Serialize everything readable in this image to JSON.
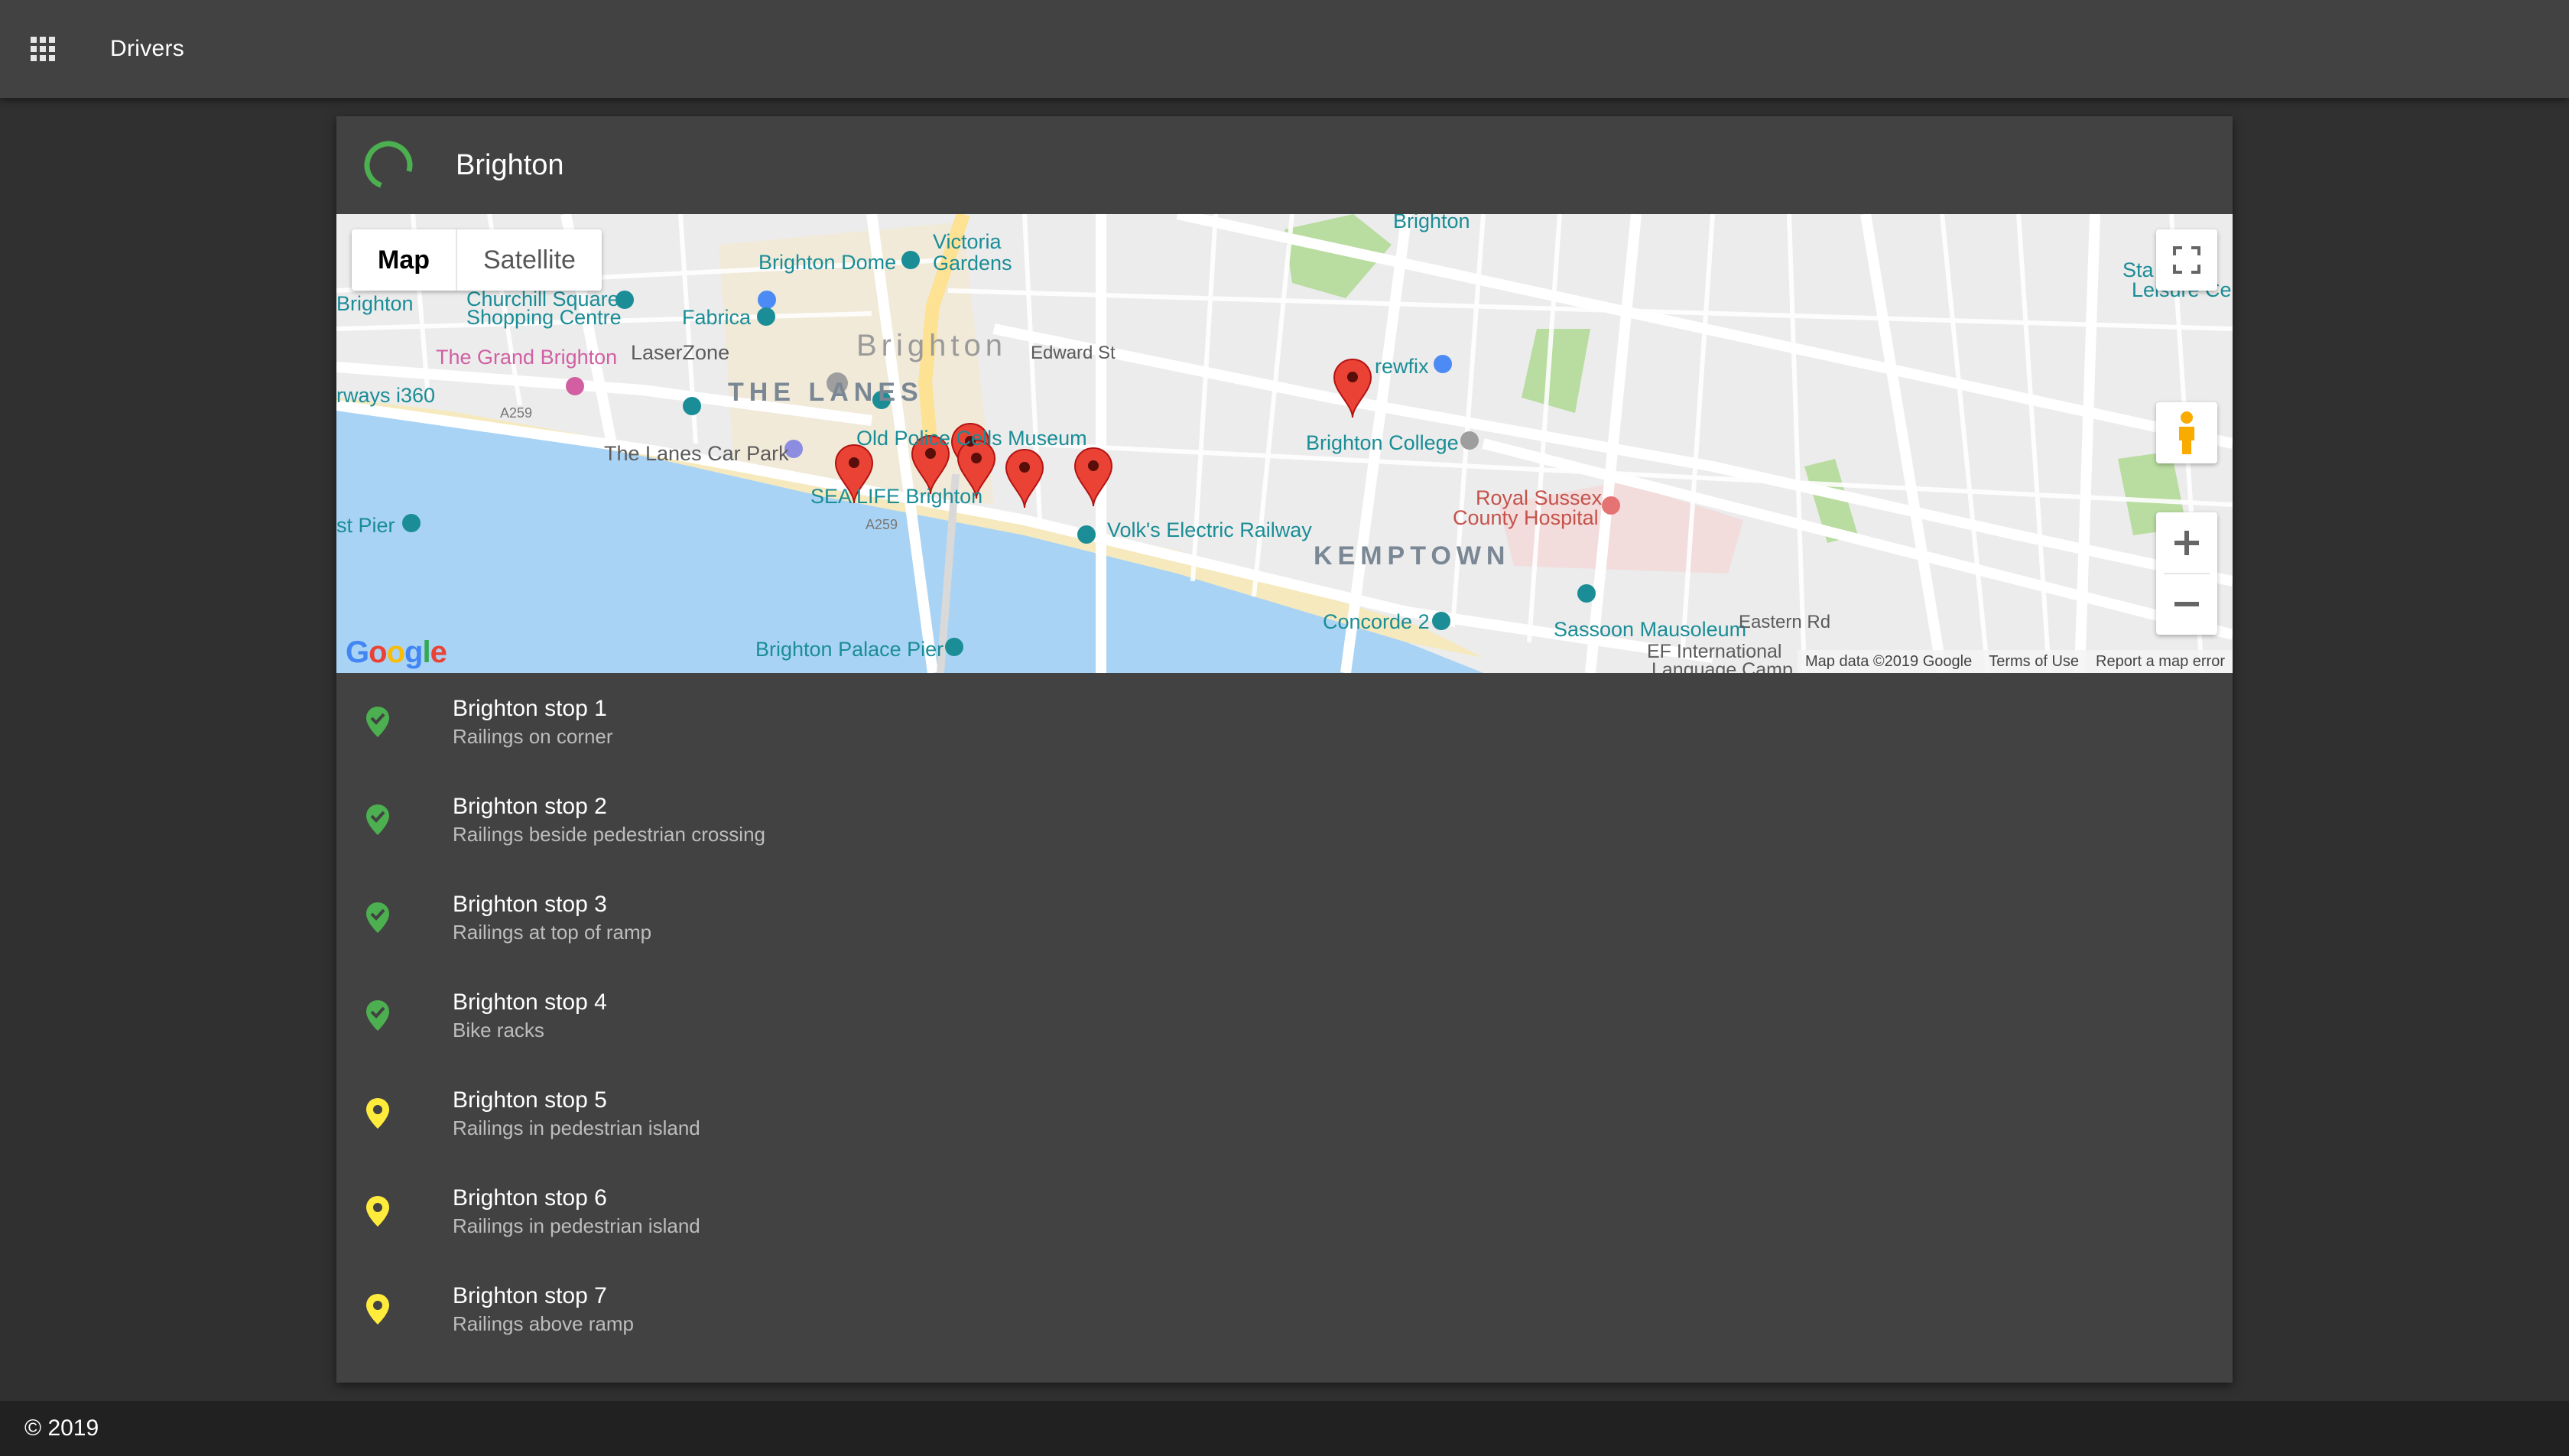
{
  "appbar": {
    "title": "Drivers",
    "apps_icon": "apps-grid-icon"
  },
  "card": {
    "title": "Brighton",
    "status_icon": "progress-spinner"
  },
  "map": {
    "type_controls": {
      "map": "Map",
      "satellite": "Satellite"
    },
    "attribution": {
      "data": "Map data ©2019 Google",
      "terms": "Terms of Use",
      "report": "Report a map error"
    },
    "logo": "Google",
    "labels": {
      "brighton_big": "Brighton",
      "the_lanes": "THE LANES",
      "kemptown": "KEMPTOWN",
      "brighton_dome": "Brighton Dome",
      "victoria_gardens": "Victoria Gardens",
      "churchill_square": "Churchill Square",
      "shopping_centre": "Shopping Centre",
      "fabrica": "Fabrica",
      "laserzone": "LaserZone",
      "grand_brighton": "The Grand Brighton",
      "i360": "rways i360",
      "brighton_left": "Brighton",
      "lanes_car_park": "The Lanes Car Park",
      "old_police": "Old Police Cells Museum",
      "sea_life": "SEA LIFE Brighton",
      "volks": "Volk's Electric Railway",
      "west_pier": "st Pier",
      "palace_pier": "Brighton Palace Pier",
      "brewfix": "rewfix",
      "brighton_college": "Brighton College",
      "royal_sussex": "Royal Sussex",
      "county_hospital": "County Hospital",
      "concorde": "Concorde 2",
      "sassoon": "Sassoon Mausoleum",
      "ef_international": "EF International",
      "language_camp": "Language Camp",
      "leisure_1": "Sta",
      "leisure_2": "Leisure Cer",
      "brighton_top": "Brighton",
      "edward_st": "Edward St",
      "eastern_rd": "Eastern Rd",
      "a259_1": "A259",
      "a259_2": "A259"
    }
  },
  "stops": [
    {
      "name": "Brighton stop 1",
      "desc": "Railings on corner",
      "status": "complete"
    },
    {
      "name": "Brighton stop 2",
      "desc": "Railings beside pedestrian crossing",
      "status": "complete"
    },
    {
      "name": "Brighton stop 3",
      "desc": "Railings at top of ramp",
      "status": "complete"
    },
    {
      "name": "Brighton stop 4",
      "desc": "Bike racks",
      "status": "complete"
    },
    {
      "name": "Brighton stop 5",
      "desc": "Railings in pedestrian island",
      "status": "pending"
    },
    {
      "name": "Brighton stop 6",
      "desc": "Railings in pedestrian island",
      "status": "pending"
    },
    {
      "name": "Brighton stop 7",
      "desc": "Railings above ramp",
      "status": "pending"
    }
  ],
  "colors": {
    "complete": "#4caf50",
    "pending": "#ffeb3b",
    "marker": "#ea4335"
  },
  "footer": {
    "copyright": "© 2019"
  }
}
